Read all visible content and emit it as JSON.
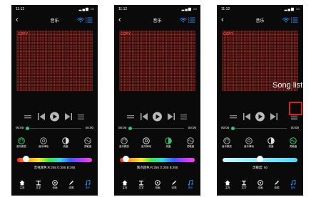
{
  "status": {
    "time": "11:12"
  },
  "header": {
    "title": "音乐"
  },
  "matrix": {
    "text": "COPY"
  },
  "progress": {
    "current": "00:00",
    "total": "00:00"
  },
  "modes": [
    {
      "label": "音乐跳变"
    },
    {
      "label": "音乐律动"
    },
    {
      "label": "亮度"
    },
    {
      "label": "灵敏度"
    }
  ],
  "screens": [
    {
      "slider_info": "音柱颜色:R:255 G:255 B:255",
      "slider_level": 0.12
    },
    {
      "slider_info": "落点颜色:R:255 G:255 B:255",
      "slider_level": 0.08
    },
    {
      "slider_info": "灵敏度: 50",
      "slider_level": 0.5
    }
  ],
  "nav": [
    {
      "label": "主页",
      "icon": "home-icon"
    },
    {
      "label": "文字",
      "icon": "text-icon"
    },
    {
      "label": "动画",
      "icon": "animation-icon"
    },
    {
      "label": "涂鸦",
      "icon": "doodle-icon"
    },
    {
      "label": "音乐",
      "icon": "music-icon"
    }
  ],
  "annotation": {
    "label": "Song list",
    "color": "#e02020"
  },
  "colors": {
    "accent": "#1e90ff",
    "matrix_led": "#c8352c",
    "progress_knob": "#35c66a"
  }
}
